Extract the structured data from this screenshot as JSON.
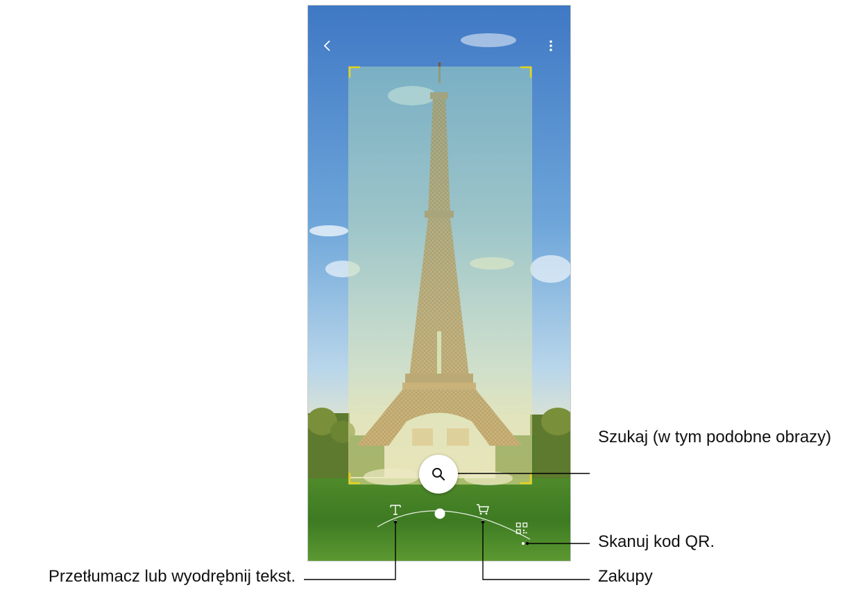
{
  "topbar": {
    "back_icon": "chevron-left-icon",
    "menu_icon": "more-vertical-icon"
  },
  "camera": {
    "subject": "eiffel-tower",
    "frame_color": "#e8d21a"
  },
  "controls": {
    "search_icon": "magnifier-icon",
    "modes": [
      {
        "icon": "text-icon",
        "glyph": "T"
      },
      {
        "icon": "cart-icon"
      },
      {
        "icon": "qr-code-icon"
      }
    ]
  },
  "callouts": {
    "search": "Szukaj (w tym podobne obrazy)",
    "qr": "Skanuj kod QR.",
    "text": "Przetłumacz lub wyodrębnij tekst.",
    "shopping": "Zakupy"
  }
}
